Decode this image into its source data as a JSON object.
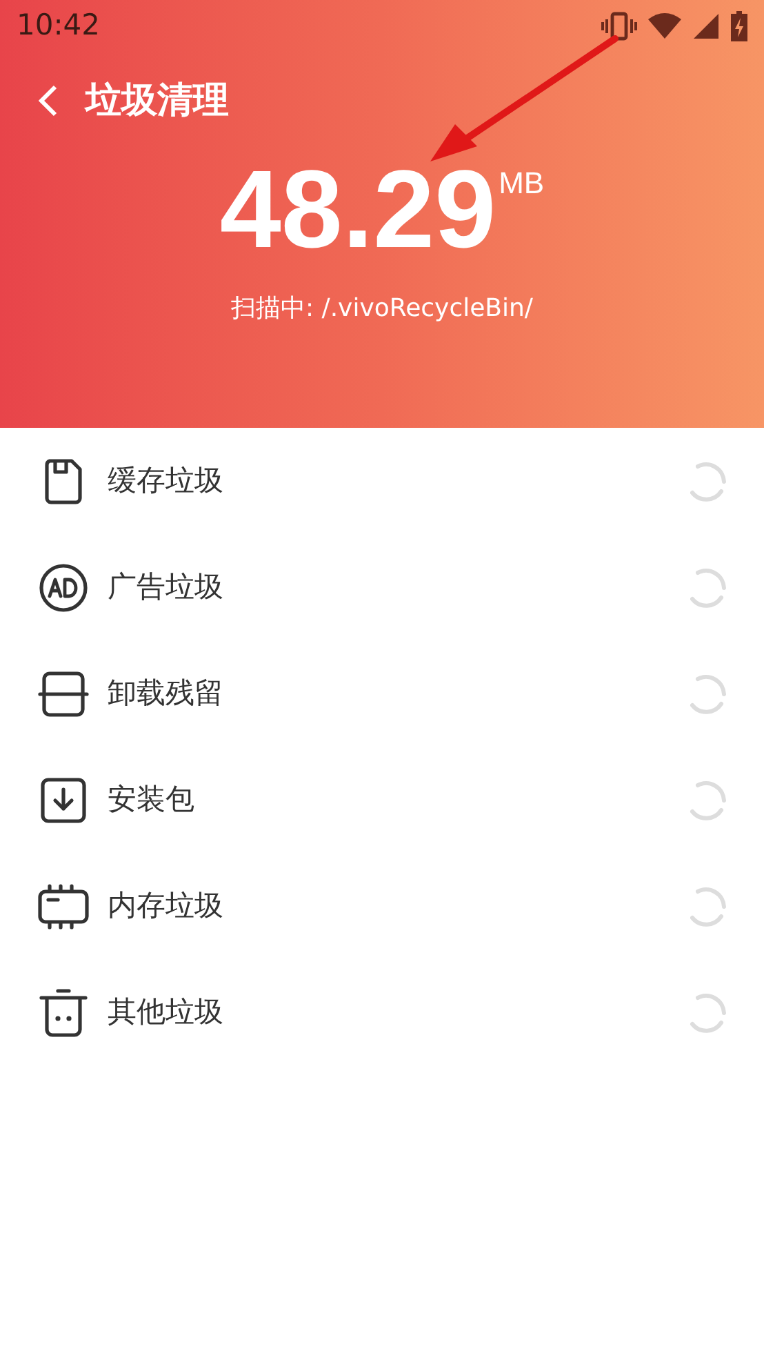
{
  "status_bar": {
    "time": "10:42"
  },
  "header": {
    "title": "垃圾清理",
    "size": "48.29",
    "unit": "MB",
    "scan_status": "扫描中: /.vivoRecycleBin/"
  },
  "items": [
    {
      "kind": "cache",
      "label": "缓存垃圾",
      "scanning": true
    },
    {
      "kind": "ad",
      "label": "广告垃圾",
      "scanning": true
    },
    {
      "kind": "residue",
      "label": "卸载残留",
      "scanning": true
    },
    {
      "kind": "package",
      "label": "安装包",
      "scanning": true
    },
    {
      "kind": "memory",
      "label": "内存垃圾",
      "scanning": true
    },
    {
      "kind": "other",
      "label": "其他垃圾",
      "scanning": true
    }
  ]
}
